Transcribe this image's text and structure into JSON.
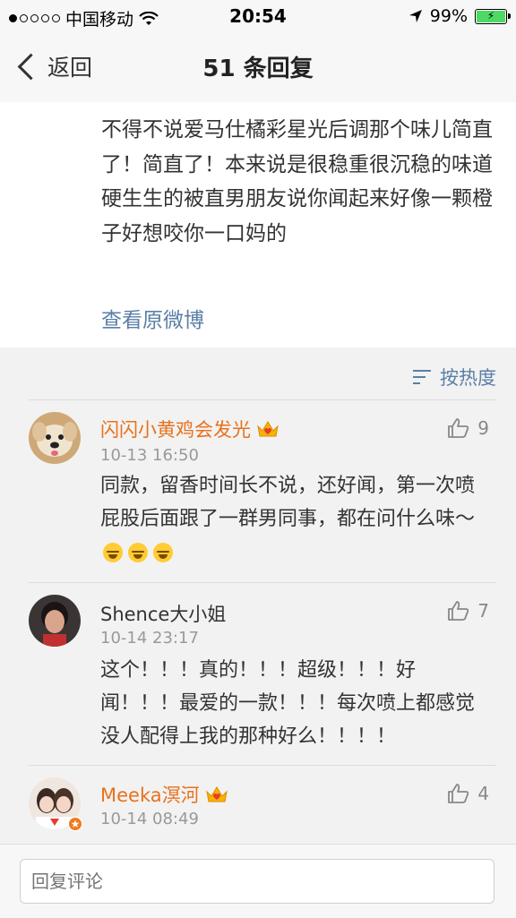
{
  "status_bar": {
    "carrier": "中国移动",
    "time": "20:54",
    "battery_percent": "99%",
    "battery_level": 0.99
  },
  "nav": {
    "back_label": "返回",
    "title": "51 条回复"
  },
  "post": {
    "text": "不得不说爱马仕橘彩星光后调那个味儿简直了！简直了！本来说是很稳重很沉稳的味道硬生生的被直男朋友说你闻起来好像一颗橙子好想咬你一口妈的",
    "view_original": "查看原微博"
  },
  "sort": {
    "label": "按热度"
  },
  "comments": [
    {
      "name": "闪闪小黄鸡会发光",
      "time": "10-13 16:50",
      "text": "同款，留香时间长不说，还好闻，第一次喷屁股后面跟了一群男同事，都在问什么味～",
      "likes": "9"
    },
    {
      "name": "Shence大小姐",
      "time": "10-14 23:17",
      "text": "这个！！！真的！！！超级！！！好闻！！！最爱的一款！！！每次喷上都感觉没人配得上我的那种好么！！！！",
      "likes": "7"
    },
    {
      "name": "Meeka溟河",
      "time": "10-14 08:49",
      "text": "",
      "likes": "4"
    }
  ],
  "reply": {
    "placeholder": "回复评论"
  }
}
